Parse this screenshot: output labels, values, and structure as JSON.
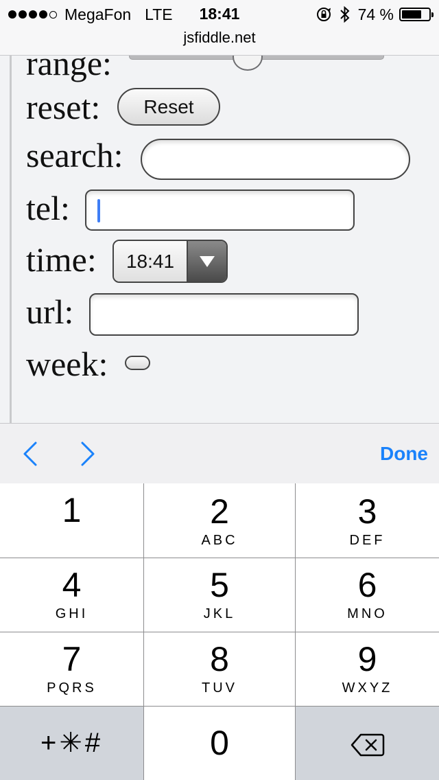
{
  "status_bar": {
    "carrier": "MegaFon",
    "network": "LTE",
    "time": "18:41",
    "battery_percent": "74 %",
    "battery_level": 0.74,
    "signal_bars": 4,
    "url": "jsfiddle.net"
  },
  "form": {
    "range_label": "range:",
    "range_value": 0.5,
    "reset_label": "reset:",
    "reset_button": "Reset",
    "search_label": "search:",
    "search_value": "",
    "tel_label": "tel:",
    "tel_value": "",
    "time_label": "time:",
    "time_value": "18:41",
    "url_label": "url:",
    "url_value": "",
    "week_label": "week:"
  },
  "accessory": {
    "done_label": "Done",
    "accent_color": "#1a82fb"
  },
  "keypad": {
    "keys": [
      {
        "num": "1",
        "letters": ""
      },
      {
        "num": "2",
        "letters": "ABC"
      },
      {
        "num": "3",
        "letters": "DEF"
      },
      {
        "num": "4",
        "letters": "GHI"
      },
      {
        "num": "5",
        "letters": "JKL"
      },
      {
        "num": "6",
        "letters": "MNO"
      },
      {
        "num": "7",
        "letters": "PQRS"
      },
      {
        "num": "8",
        "letters": "TUV"
      },
      {
        "num": "9",
        "letters": "WXYZ"
      }
    ],
    "symbols": "+✳#",
    "zero": "0",
    "delete_icon": "backspace-icon"
  }
}
